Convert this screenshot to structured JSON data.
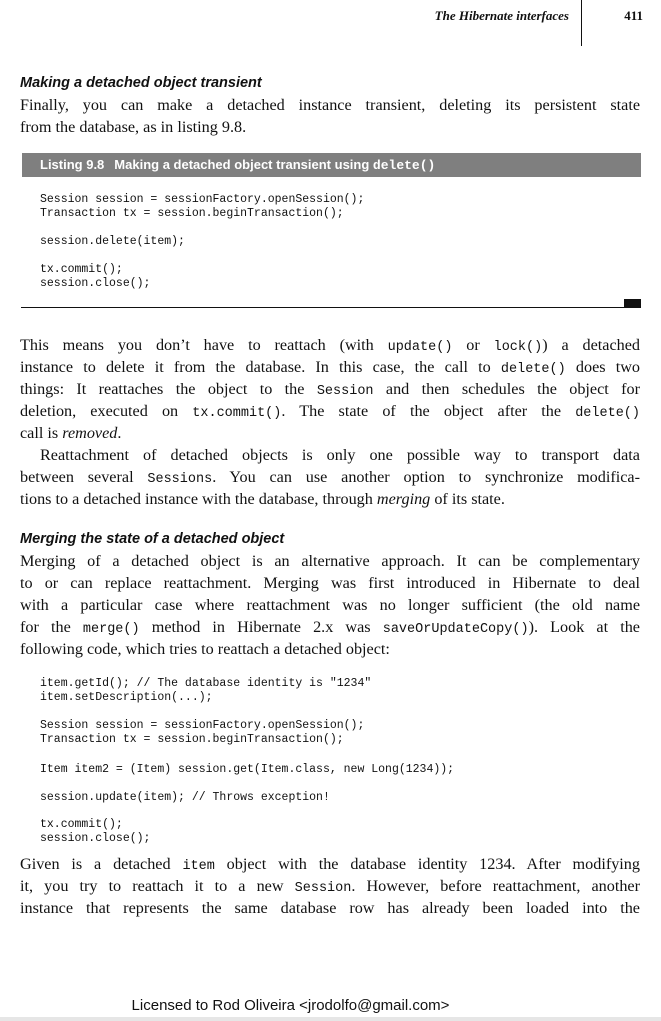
{
  "header": {
    "running_title": "The Hibernate interfaces",
    "page_number": "411"
  },
  "section1": {
    "heading": "Making a detached object transient",
    "intro_lines": [
      "Finally, you can make a detached instance transient, deleting its persistent state",
      "from the database, as in listing 9.8."
    ]
  },
  "listing": {
    "label": "Listing 9.8",
    "caption_text": "Making a detached object transient using",
    "caption_code": "delete()",
    "lines": [
      "Session session = sessionFactory.openSession();",
      "Transaction tx = session.beginTransaction();",
      "session.delete(item);",
      "tx.commit();",
      "session.close();"
    ]
  },
  "para1": {
    "l1a": "This means you don’t have to reattach (with ",
    "l1b": "update()",
    "l1c": " or ",
    "l1d": "lock()",
    "l1e": ") a detached",
    "l2a": "instance to delete it from the database. In this case, the call to ",
    "l2b": "delete()",
    "l2c": " does two",
    "l3a": "things: It reattaches the object to the ",
    "l3b": "Session",
    "l3c": " and then schedules the object for",
    "l4a": "deletion, executed on ",
    "l4b": "tx.commit()",
    "l4c": ". The state of the object after the ",
    "l4d": "delete()",
    "l5a": "call is ",
    "l5b": "removed",
    "l5c": "."
  },
  "para2": {
    "l1": "Reattachment of detached objects is only one possible way to transport data",
    "l2a": "between several ",
    "l2b": "Sessions",
    "l2c": ". You can use another option to synchronize modifica-",
    "l3a": "tions to a detached instance with the database, through ",
    "l3b": "merging",
    "l3c": " of its state."
  },
  "section2": {
    "heading": "Merging the state of a detached object",
    "l1": "Merging of a detached object is an alternative approach. It can be complementary",
    "l2": "to or can replace reattachment. Merging was first introduced in Hibernate to deal",
    "l3": "with a particular case where reattachment was no longer sufficient (the old name",
    "l4a": "for the ",
    "l4b": "merge()",
    "l4c": " method in Hibernate 2.x was ",
    "l4d": "saveOrUpdateCopy()",
    "l4e": "). Look at the",
    "l5": "following code, which tries to reattach a detached object:"
  },
  "code2": {
    "lines": [
      "item.getId(); // The database identity is \"1234\"",
      "item.setDescription(...);",
      "Session session = sessionFactory.openSession();",
      "Transaction tx = session.beginTransaction();",
      "Item item2 = (Item) session.get(Item.class, new Long(1234));",
      "session.update(item); // Throws exception!",
      "tx.commit();",
      "session.close();"
    ]
  },
  "para3": {
    "l1a": "Given is a detached ",
    "l1b": "item",
    "l1c": " object with the database identity 1234. After modifying",
    "l2a": "it, you try to reattach it to a new ",
    "l2b": "Session",
    "l2c": ". However, before reattachment, another",
    "l3": "instance that represents the same database row has already been loaded into the"
  },
  "footer": {
    "license": "Licensed to Rod Oliveira <jrodolfo@gmail.com>"
  }
}
